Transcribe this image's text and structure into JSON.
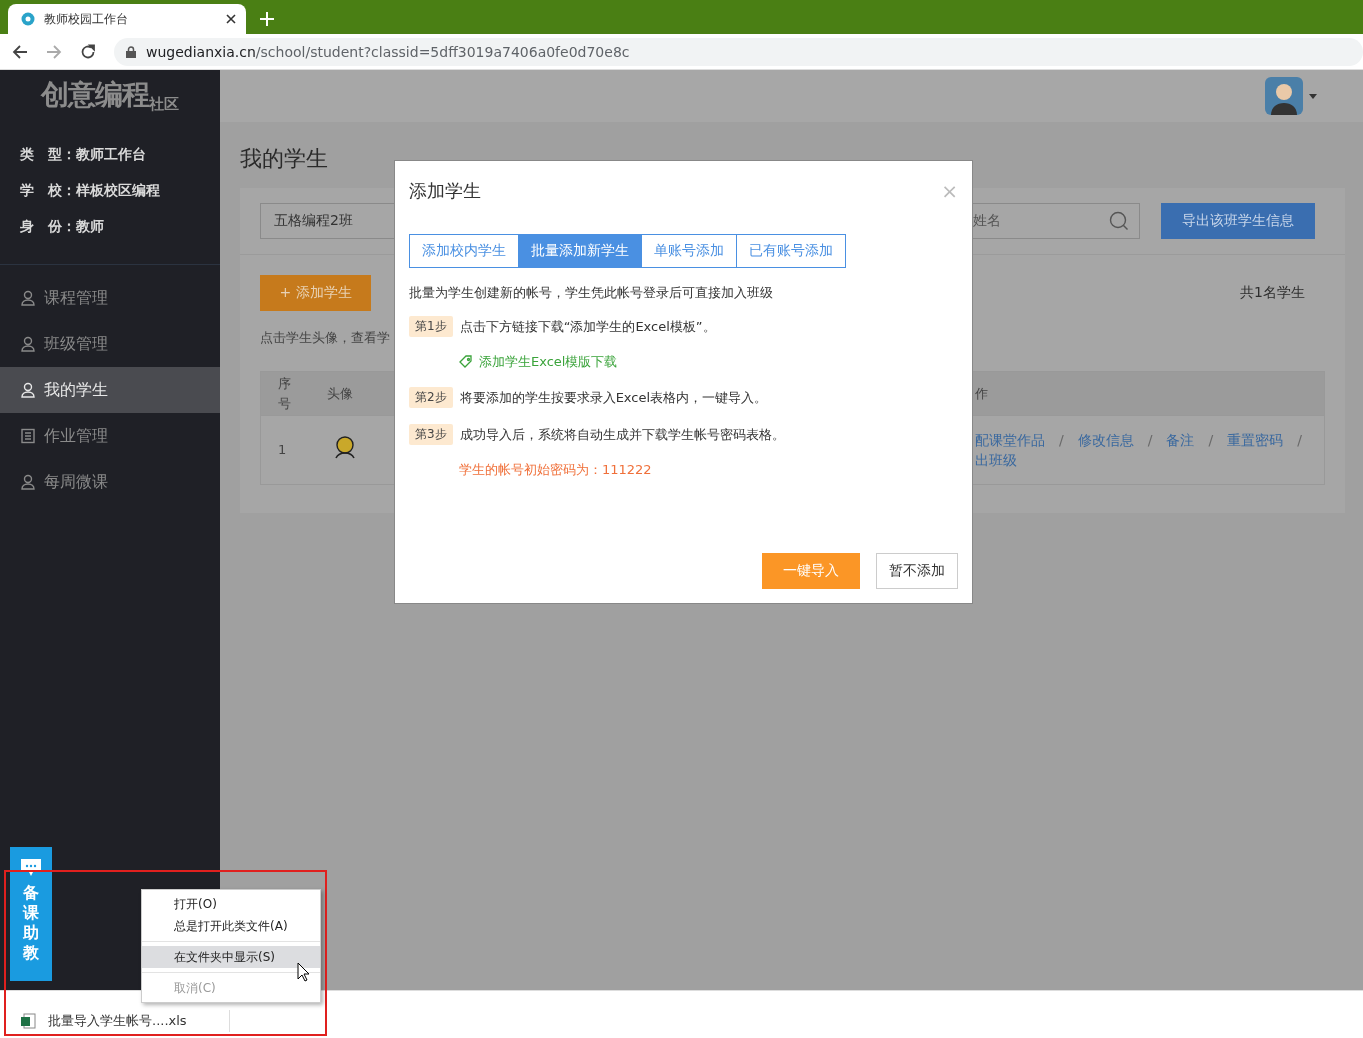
{
  "browser": {
    "tab_title": "教师校园工作台",
    "url_host": "wugedianxia.cn",
    "url_path": "/school/student?classid=5dff3019a7406a0fe0d70e8c"
  },
  "sidebar": {
    "logo": "创意编程",
    "logo_suffix": "社区",
    "info": [
      {
        "label": "类　型：",
        "value": "教师工作台"
      },
      {
        "label": "学　校：",
        "value": "样板校区编程"
      },
      {
        "label": "身　份：",
        "value": "教师"
      }
    ],
    "items": [
      {
        "label": "课程管理",
        "kind": "user",
        "selected": false
      },
      {
        "label": "班级管理",
        "kind": "user",
        "selected": false
      },
      {
        "label": "我的学生",
        "kind": "user",
        "selected": true
      },
      {
        "label": "作业管理",
        "kind": "doc",
        "selected": false
      },
      {
        "label": "每周微课",
        "kind": "user",
        "selected": false
      }
    ]
  },
  "page": {
    "title": "我的学生",
    "class_select": "五格编程2班",
    "search": {
      "placeholder": "姓名"
    },
    "export_button": "导出该班学生信息",
    "add_button": "+ 添加学生",
    "count": "共1名学生",
    "hint": "点击学生头像，查看学",
    "table": {
      "columns": [
        "序号",
        "头像",
        "作"
      ],
      "rows": [
        {
          "index": "1",
          "actions": [
            "配课堂作品",
            "修改信息",
            "备注",
            "重置密码"
          ],
          "action_separator": "/",
          "actions_line_2": "出班级"
        }
      ]
    }
  },
  "dialog": {
    "title": "添加学生",
    "close": "×",
    "tabs": [
      {
        "label": "添加校内学生",
        "selected": false
      },
      {
        "label": "批量添加新学生",
        "selected": true
      },
      {
        "label": "单账号添加",
        "selected": false
      },
      {
        "label": "已有账号添加",
        "selected": false
      }
    ],
    "intro": "批量为学生创建新的帐号，学生凭此帐号登录后可直接加入班级",
    "steps": [
      {
        "badge": "第1步",
        "text": "点击下方链接下载“添加学生的Excel模板”。"
      },
      {
        "kind": "link",
        "text": "添加学生Excel模版下载"
      },
      {
        "badge": "第2步",
        "text": "将要添加的学生按要求录入Excel表格内，一键导入。"
      },
      {
        "badge": "第3步",
        "text": "成功导入后，系统将自动生成并下载学生帐号密码表格。"
      },
      {
        "kind": "note",
        "text": "学生的帐号初始密码为：111222"
      }
    ],
    "buttons": [
      {
        "label": "一键导入",
        "kind": "primary"
      },
      {
        "label": "暂不添加",
        "kind": "default"
      }
    ]
  },
  "helper": {
    "label": "备课助教"
  },
  "context_menu": {
    "items": [
      {
        "label": "打开(O)",
        "disabled": false,
        "selected": false
      },
      {
        "label": "总是打开此类文件(A)",
        "disabled": false,
        "selected": false
      },
      {
        "kind": "separator"
      },
      {
        "label": "在文件夹中显示(S)",
        "disabled": false,
        "selected": true
      },
      {
        "kind": "separator"
      },
      {
        "label": "取消(C)",
        "disabled": true,
        "selected": false
      }
    ]
  },
  "download": {
    "filename": "批量导入学生帐号....xls"
  }
}
